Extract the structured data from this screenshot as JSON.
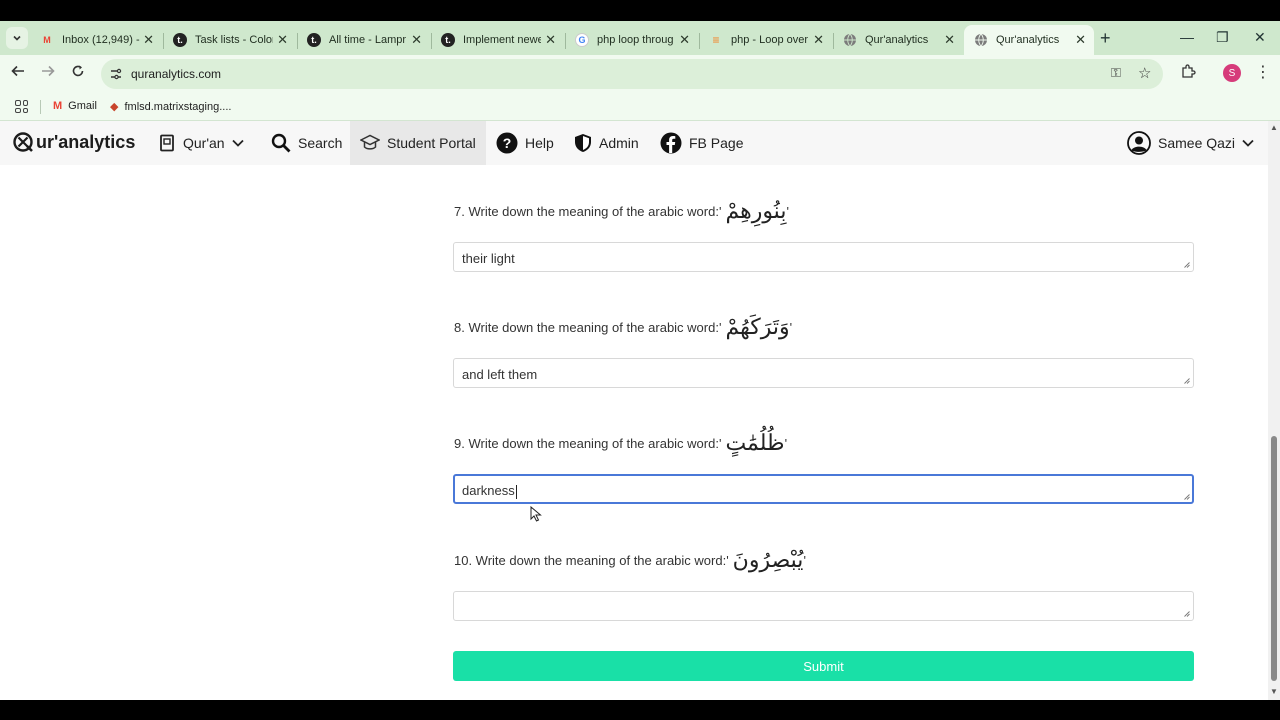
{
  "browser": {
    "tabs": [
      {
        "title": "Inbox (12,949) -",
        "favicon": "gmail-icon",
        "fav_color": "#ea4335",
        "fav_text": "M"
      },
      {
        "title": "Task lists - Color",
        "favicon": "t-icon",
        "fav_color": "#222222",
        "fav_text": "t."
      },
      {
        "title": "All time - Lampr",
        "favicon": "t-icon",
        "fav_color": "#222222",
        "fav_text": "t."
      },
      {
        "title": "Implement newe",
        "favicon": "t-icon",
        "fav_color": "#222222",
        "fav_text": "t."
      },
      {
        "title": "php loop throug",
        "favicon": "google-icon",
        "fav_color": "#4285f4",
        "fav_text": "G"
      },
      {
        "title": "php - Loop over",
        "favicon": "stackoverflow-icon",
        "fav_color": "#f48024",
        "fav_text": "≡"
      },
      {
        "title": "Qur'analytics",
        "favicon": "globe-icon",
        "fav_color": "#777777",
        "fav_text": ""
      },
      {
        "title": "Qur'analytics",
        "favicon": "globe-icon",
        "fav_color": "#777777",
        "fav_text": "",
        "active": true
      }
    ],
    "url": "quranalytics.com",
    "bookmarks": [
      {
        "label": "Gmail",
        "icon": "gmail-icon"
      },
      {
        "label": "fmlsd.matrixstaging....",
        "icon": "bookmark-site-icon"
      }
    ],
    "profile_initial": "S"
  },
  "nav": {
    "logo_text": "ur'analytics",
    "items": [
      {
        "label": "Qur'an",
        "icon": "book-icon",
        "has_dropdown": true
      },
      {
        "label": "Search",
        "icon": "search-icon"
      },
      {
        "label": "Student Portal",
        "icon": "graduation-icon",
        "active": true
      },
      {
        "label": "Help",
        "icon": "help-icon"
      },
      {
        "label": "Admin",
        "icon": "shield-icon"
      },
      {
        "label": "FB Page",
        "icon": "facebook-icon"
      }
    ],
    "user": {
      "name": "Samee Qazi",
      "icon": "user-icon"
    }
  },
  "quiz": {
    "questions": [
      {
        "label": "7. Write down the meaning of the arabic word: ",
        "word": "بِنُورِهِمْ",
        "answer": "their light"
      },
      {
        "label": "8. Write down the meaning of the arabic word: ",
        "word": "وَتَرَكَهُمْ",
        "answer": "and left them"
      },
      {
        "label": "9. Write down the meaning of the arabic word: ",
        "word": "ظُلُمَٰتٍ",
        "answer": "darkness",
        "focused": true
      },
      {
        "label": "10. Write down the meaning of the arabic word: ",
        "word": "يُبْصِرُونَ",
        "answer": ""
      }
    ],
    "submit_label": "Submit"
  },
  "colors": {
    "accent": "#19e0a7",
    "focus": "#4a78d8",
    "chrome": "#cfe8cd"
  }
}
